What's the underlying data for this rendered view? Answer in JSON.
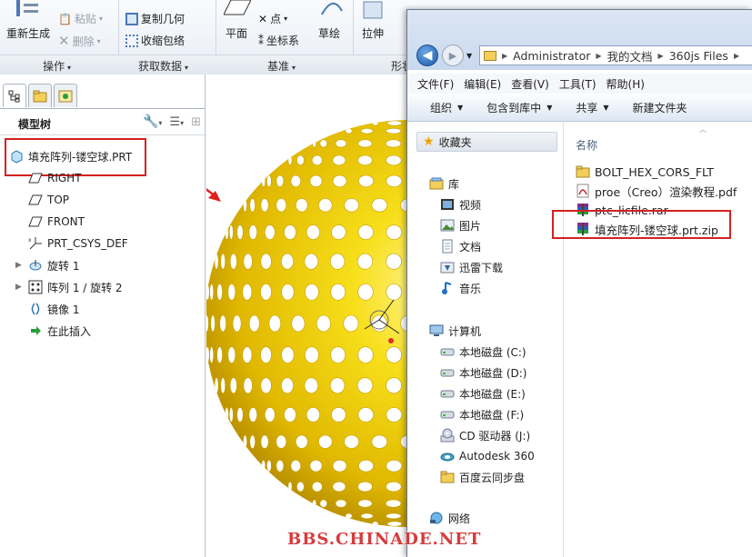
{
  "ribbon": {
    "regenerate": "重新生成",
    "paste": "粘贴",
    "delete": "删除",
    "copy_geometry": "复制几何",
    "shrinkwrap": "收缩包络",
    "plane": "平面",
    "point": "点",
    "coord_sys": "坐标系",
    "sketch": "草绘",
    "extrude": "拉伸",
    "groups": {
      "operations": "操作",
      "get_data": "获取数据",
      "datum": "基准",
      "shapes": "形状"
    }
  },
  "model_tree": {
    "title": "模型树",
    "root": "填充阵列-镂空球.PRT",
    "items": [
      {
        "label": "RIGHT",
        "icon": "datum-plane-icon",
        "expandable": false
      },
      {
        "label": "TOP",
        "icon": "datum-plane-icon",
        "expandable": false
      },
      {
        "label": "FRONT",
        "icon": "datum-plane-icon",
        "expandable": false
      },
      {
        "label": "PRT_CSYS_DEF",
        "icon": "csys-icon",
        "expandable": false
      },
      {
        "label": "旋转 1",
        "icon": "revolve-icon",
        "expandable": true
      },
      {
        "label": "阵列 1 / 旋转 2",
        "icon": "pattern-icon",
        "expandable": true
      },
      {
        "label": "镜像 1",
        "icon": "mirror-icon",
        "expandable": false
      },
      {
        "label": "在此插入",
        "icon": "insert-here-icon",
        "expandable": false
      }
    ]
  },
  "explorer": {
    "breadcrumbs": [
      "Administrator",
      "我的文档",
      "360js Files"
    ],
    "menu": [
      "文件(F)",
      "编辑(E)",
      "查看(V)",
      "工具(T)",
      "帮助(H)"
    ],
    "toolbar": [
      "组织",
      "包含到库中",
      "共享",
      "新建文件夹"
    ],
    "nav": {
      "favorites": "收藏夹",
      "libraries": "库",
      "library_items": [
        "视频",
        "图片",
        "文档",
        "迅雷下载",
        "音乐"
      ],
      "computer": "计算机",
      "drives": [
        "本地磁盘 (C:)",
        "本地磁盘 (D:)",
        "本地磁盘 (E:)",
        "本地磁盘 (F:)",
        "CD 驱动器 (J:)",
        "Autodesk 360",
        "百度云同步盘"
      ],
      "network": "网络"
    },
    "column_name": "名称",
    "files": [
      {
        "name": "BOLT_HEX_CORS_FLT",
        "icon": "folder-icon"
      },
      {
        "name": "proe（Creo）渲染教程.pdf",
        "icon": "pdf-icon"
      },
      {
        "name": "ptc_licfile.rar",
        "icon": "rar-icon"
      },
      {
        "name": "填充阵列-镂空球.prt.zip",
        "icon": "zip-archive-icon"
      }
    ]
  },
  "watermark": "BBS.CHINADE.NET",
  "colors": {
    "highlight_box": "#d42121",
    "sphere": "#f5d800",
    "arrow": "#e02020"
  }
}
